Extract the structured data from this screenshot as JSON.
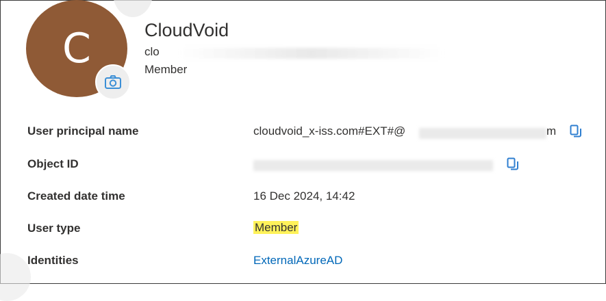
{
  "profile": {
    "initial": "C",
    "name": "CloudVoid",
    "email_visible": "clo",
    "role": "Member"
  },
  "details": {
    "rows": [
      {
        "label": "User principal name",
        "value": "cloudvoid_x-iss.com#EXT#@",
        "trail": "m"
      },
      {
        "label": "Object ID",
        "value": ""
      },
      {
        "label": "Created date time",
        "value": "16 Dec 2024, 14:42"
      },
      {
        "label": "User type",
        "value": "Member"
      },
      {
        "label": "Identities",
        "value": "ExternalAzureAD"
      }
    ]
  },
  "icons": {
    "camera": "camera-icon",
    "copy": "copy-icon"
  },
  "colors": {
    "avatar": "#8f5a36",
    "link": "#0067b8",
    "highlight": "#fff25a"
  }
}
